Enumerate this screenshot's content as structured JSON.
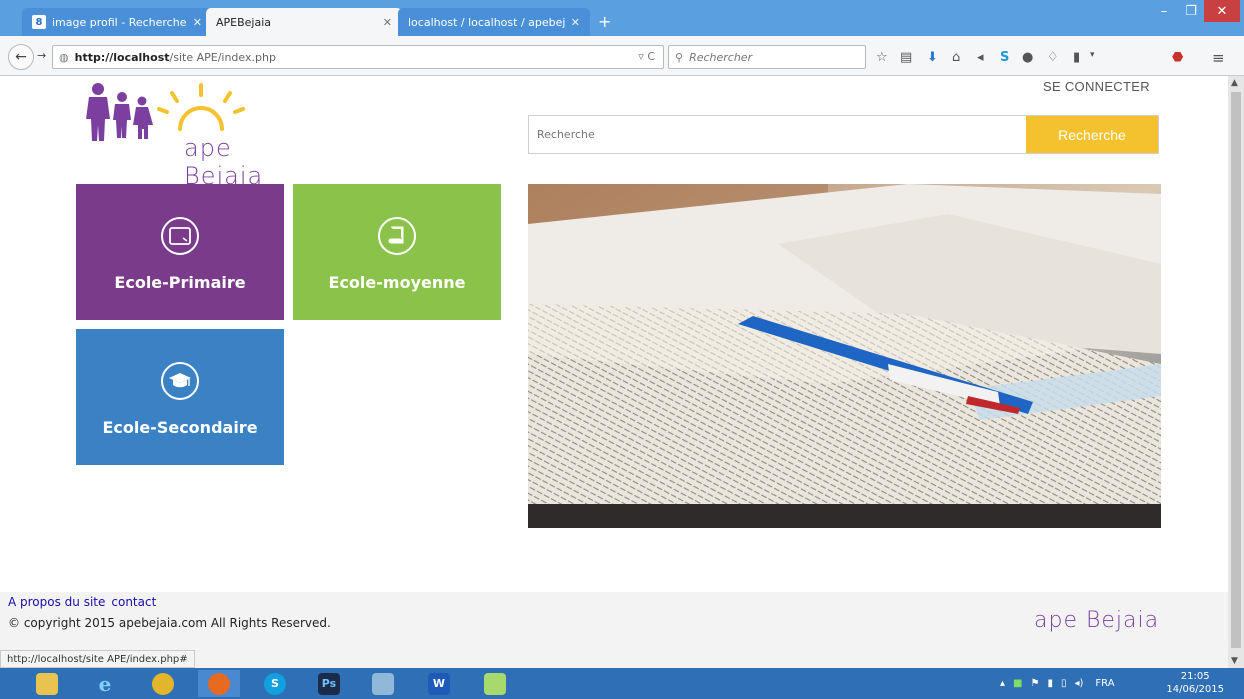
{
  "browser": {
    "tabs": [
      {
        "title": "image profil - Recherche G...",
        "active": false,
        "favicon": "google-plus-icon"
      },
      {
        "title": "APEBejaia",
        "active": true,
        "favicon": "none"
      },
      {
        "title": "localhost / localhost / apebejai...",
        "active": false,
        "favicon": "none"
      }
    ],
    "url_host": "http://localhost",
    "url_path": "/site APE/index.php",
    "search_placeholder": "Rechercher",
    "status_url": "http://localhost/site APE/index.php#"
  },
  "site": {
    "logo_text": "ape Bejaia",
    "connect_label": "SE CONNECTER",
    "search": {
      "placeholder": "Recherche",
      "button": "Recherche"
    },
    "tiles": [
      {
        "label": "Ecole-Primaire",
        "color": "#7a3c8a",
        "icon": "tablet-icon"
      },
      {
        "label": "Ecole-moyenne",
        "color": "#8bc34a",
        "icon": "book-icon"
      },
      {
        "label": "Ecole-Secondaire",
        "color": "#3b82c4",
        "icon": "graduation-cap-icon"
      }
    ],
    "footer": {
      "link_about": "A propos du site",
      "link_contact": "contact",
      "copyright": "© copyright 2015 apebejaia.com All Rights Reserved.",
      "brand": "ape Bejaia"
    },
    "accent_color": "#f5c22f",
    "brand_color": "#7b3fa0"
  },
  "taskbar": {
    "language": "FRA",
    "time": "21:05",
    "date": "14/06/2015"
  }
}
